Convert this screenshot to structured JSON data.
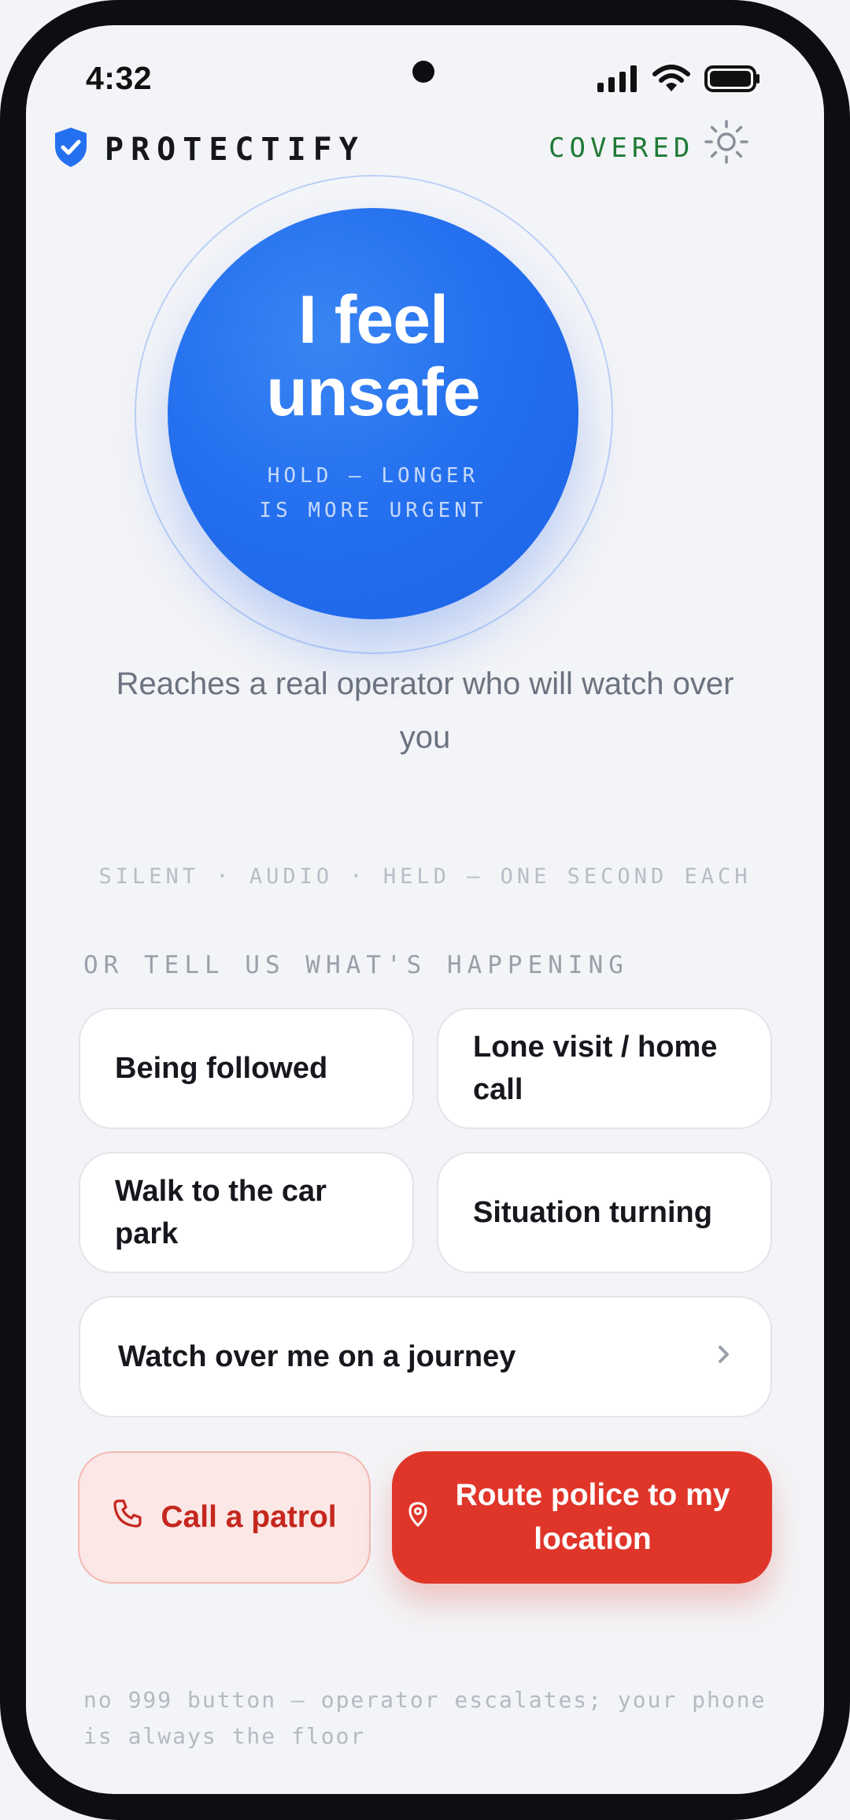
{
  "status_bar": {
    "time": "4:32",
    "icons": [
      "signal-icon",
      "wifi-icon",
      "battery-icon"
    ]
  },
  "header": {
    "brand": "PROTECTIFY",
    "logo_icon": "shield-check-icon",
    "status": "COVERED",
    "status_color": "#1f7a36",
    "settings_icon": "sun-icon"
  },
  "panic": {
    "line1": "I feel",
    "line2": "unsafe",
    "hint": "HOLD — LONGER\nIS MORE URGENT",
    "color": "#2470ef"
  },
  "description": "Reaches a real operator who will watch over you",
  "modes": "SILENT · AUDIO · HELD — ONE SECOND EACH",
  "section_title": "OR TELL US WHAT'S HAPPENING",
  "situations": [
    {
      "label": "Being followed"
    },
    {
      "label": "Lone visit / home call"
    },
    {
      "label": "Walk to the car park"
    },
    {
      "label": "Situation turning"
    }
  ],
  "journey": {
    "label": "Watch over me on a journey",
    "icon": "chevron-right-icon"
  },
  "actions": {
    "patrol": {
      "label": "Call a patrol",
      "icon": "phone-icon",
      "color": "#c5271f"
    },
    "route": {
      "label": "Route police to my location",
      "icon": "location-pin-icon",
      "color": "#e0362a"
    }
  },
  "footnote": "no 999 button — operator escalates; your phone is always the floor"
}
